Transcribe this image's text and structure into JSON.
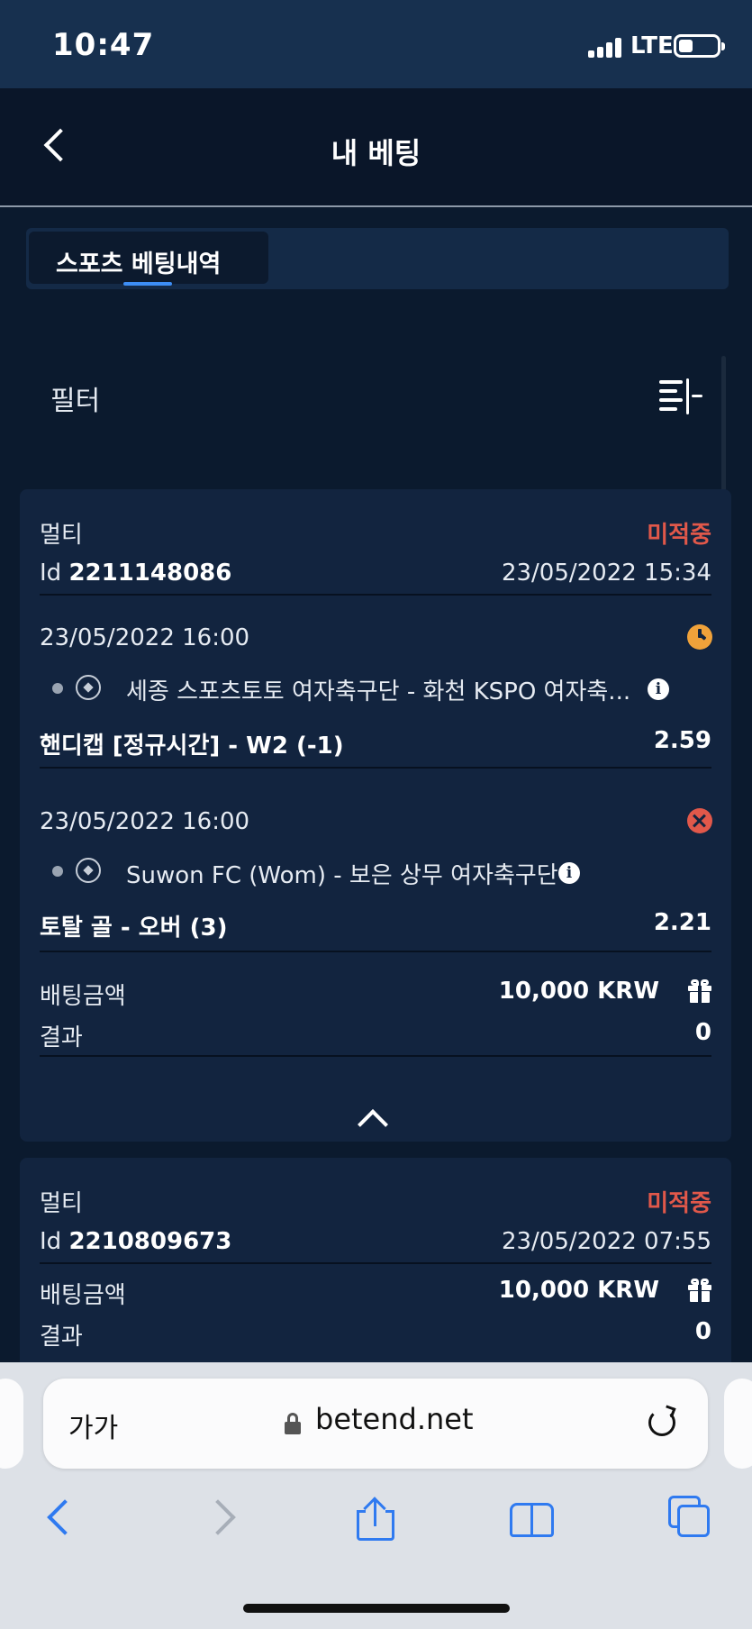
{
  "status_bar": {
    "time": "10:47",
    "network": "LTE"
  },
  "header": {
    "title": "내 베팅"
  },
  "tabs": [
    {
      "label": "스포츠 베팅내역",
      "active": true
    }
  ],
  "filter": {
    "label": "필터"
  },
  "bets": [
    {
      "type": "멀티",
      "status": "미적중",
      "id_label": "Id",
      "id": "2211148086",
      "placed_at": "23/05/2022 15:34",
      "selections": [
        {
          "event_time": "23/05/2022 16:00",
          "state_icon": "clock-icon",
          "match": "세종 스포츠토토 여자축구단 - 화천 KSPO 여자축...",
          "market": "핸디캡 [정규시간] - W2 (-1)",
          "odds": "2.59"
        },
        {
          "event_time": "23/05/2022 16:00",
          "state_icon": "lost-x-icon",
          "match": "Suwon FC (Wom) - 보은 상무 여자축구단",
          "market": "토탈 골 - 오버 (3)",
          "odds": "2.21"
        }
      ],
      "stake_label": "배팅금액",
      "stake": "10,000 KRW",
      "result_label": "결과",
      "result": "0"
    },
    {
      "type": "멀티",
      "status": "미적중",
      "id_label": "Id",
      "id": "2210809673",
      "placed_at": "23/05/2022 07:55",
      "stake_label": "배팅금액",
      "stake": "10,000 KRW",
      "result_label": "결과",
      "result": "0"
    }
  ],
  "browser": {
    "text_size_label": "가가",
    "url": "betend.net"
  },
  "colors": {
    "lost": "#e1584a",
    "pending": "#f0a23a",
    "accent": "#3d8ef5",
    "safari_blue": "#2f7af0"
  }
}
